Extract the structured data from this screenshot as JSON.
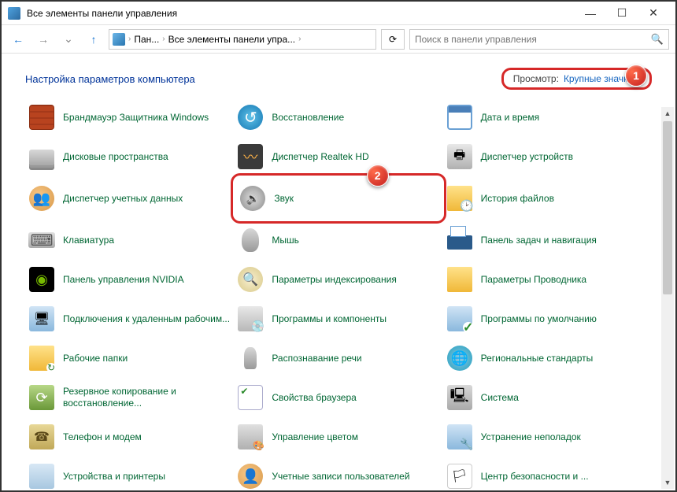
{
  "window": {
    "title": "Все элементы панели управления"
  },
  "breadcrumb": {
    "seg1": "Пан...",
    "seg2": "Все элементы панели упра..."
  },
  "search": {
    "placeholder": "Поиск в панели управления"
  },
  "header": {
    "title": "Настройка параметров компьютера",
    "view_label": "Просмотр:",
    "view_value": "Крупные значки"
  },
  "callouts": {
    "c1": "1",
    "c2": "2"
  },
  "items": [
    {
      "label": "Брандмауэр Защитника Windows",
      "icon": "ic-firewall"
    },
    {
      "label": "Восстановление",
      "icon": "ic-restore"
    },
    {
      "label": "Дата и время",
      "icon": "ic-date"
    },
    {
      "label": "Дисковые пространства",
      "icon": "ic-disk"
    },
    {
      "label": "Диспетчер Realtek HD",
      "icon": "ic-realtek"
    },
    {
      "label": "Диспетчер устройств",
      "icon": "ic-device"
    },
    {
      "label": "Диспетчер учетных данных",
      "icon": "ic-users"
    },
    {
      "label": "Звук",
      "icon": "ic-sound"
    },
    {
      "label": "История файлов",
      "icon": "ic-history"
    },
    {
      "label": "Клавиатура",
      "icon": "ic-keyboard"
    },
    {
      "label": "Мышь",
      "icon": "ic-mouse"
    },
    {
      "label": "Панель задач и навигация",
      "icon": "ic-taskbar"
    },
    {
      "label": "Панель управления NVIDIA",
      "icon": "ic-nvidia"
    },
    {
      "label": "Параметры индексирования",
      "icon": "ic-index"
    },
    {
      "label": "Параметры Проводника",
      "icon": "ic-explorer"
    },
    {
      "label": "Подключения к удаленным рабочим...",
      "icon": "ic-remote"
    },
    {
      "label": "Программы и компоненты",
      "icon": "ic-programs"
    },
    {
      "label": "Программы по умолчанию",
      "icon": "ic-defaults"
    },
    {
      "label": "Рабочие папки",
      "icon": "ic-workfolders"
    },
    {
      "label": "Распознавание речи",
      "icon": "ic-speech"
    },
    {
      "label": "Региональные стандарты",
      "icon": "ic-region"
    },
    {
      "label": "Резервное копирование и восстановление...",
      "icon": "ic-backup"
    },
    {
      "label": "Свойства браузера",
      "icon": "ic-browser"
    },
    {
      "label": "Система",
      "icon": "ic-system"
    },
    {
      "label": "Телефон и модем",
      "icon": "ic-phone"
    },
    {
      "label": "Управление цветом",
      "icon": "ic-color"
    },
    {
      "label": "Устранение неполадок",
      "icon": "ic-trouble"
    },
    {
      "label": "Устройства и принтеры",
      "icon": "ic-generic"
    },
    {
      "label": "Учетные записи пользователей",
      "icon": "ic-accounts"
    },
    {
      "label": "Центр безопасности и ...",
      "icon": "ic-security"
    }
  ]
}
